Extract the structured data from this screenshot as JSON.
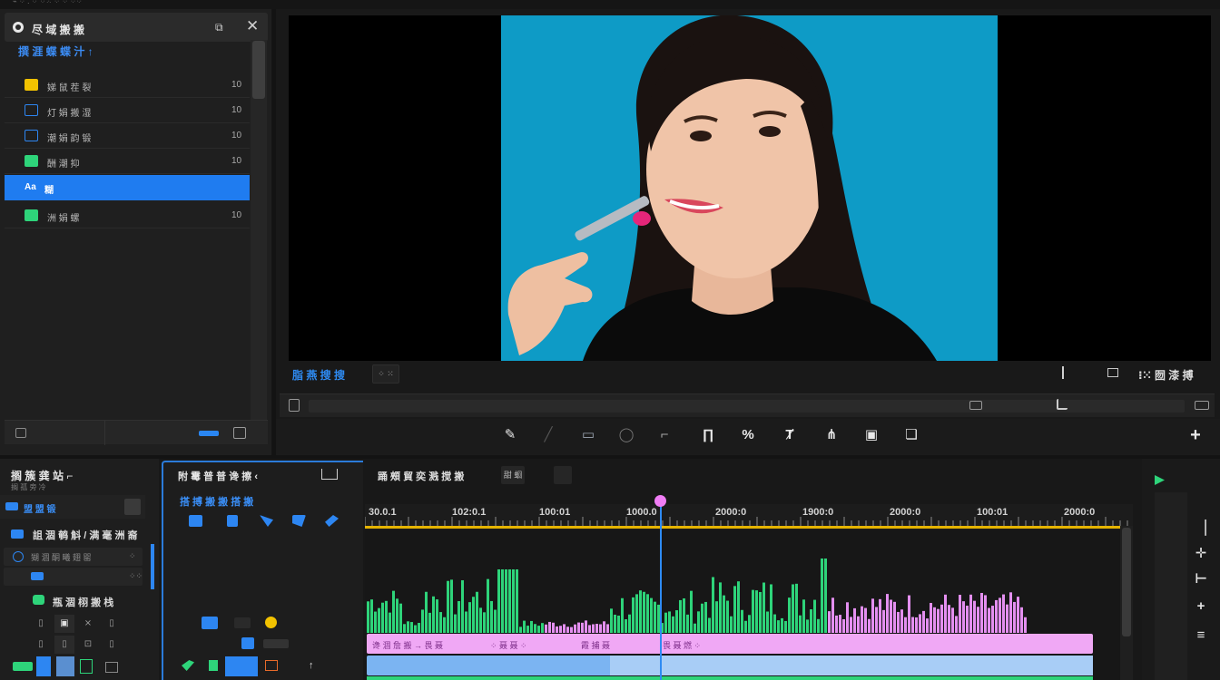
{
  "window": {
    "top_strip": "⌁ ⁘ ⁚ ⁘ ⁘⁙ ⁘ ⁘ ⁘⁘"
  },
  "left_panel": {
    "title": "尽 域 搬 搬",
    "section_title": "撰 涯 蝶 蝶 汁 ↑",
    "items": [
      {
        "label": "娣 鼠 茬 裂",
        "value": "10",
        "icon": "yellow-folder-icon",
        "color": "#f2c200"
      },
      {
        "label": "灯  娟 搬 湿",
        "value": "10",
        "icon": "video-frame-icon",
        "color": "#2d86f2"
      },
      {
        "label": "潮 娟 韵 锻",
        "value": "10",
        "icon": "download-icon",
        "color": "#2d86f2"
      },
      {
        "label": "酬 潮 抑",
        "value": "10",
        "icon": "image-icon",
        "color": "#2ed47a"
      },
      {
        "label": "糊",
        "value": "",
        "icon": "ae-icon",
        "color": "#1f7cf0",
        "active": true,
        "prefix": "Aa"
      },
      {
        "label": "洲 娟 螺",
        "value": "10",
        "icon": "grid-icon",
        "color": "#2ed47a"
      }
    ]
  },
  "viewer": {
    "label": "脂 燕 搜 搜",
    "badge": "⁘ ⁙",
    "right_label": "⁝⁙ 囫 漆 搏",
    "image_desc": "preview-frame"
  },
  "scrubber": {
    "icons": [
      "film-icon",
      "marker-icon",
      "marker-icon",
      "ruler-icon"
    ]
  },
  "toolbar": {
    "items": [
      "✎",
      "╱",
      "▭",
      "◯",
      "⌐",
      "∏",
      "%",
      "Ⱦ",
      "⋔",
      "▣",
      "❏",
      "+"
    ]
  },
  "project": {
    "title": "搁 簇 龚 站 ⌐",
    "subtitle": "搁 孤 旁 冷",
    "row1_label": "盟 盟 锻",
    "folder": "詛 涸 鹌 斛 / 满 毫 洲 裔",
    "items": [
      {
        "label": "猢 涸 酮 曦 翅 罂",
        "num": "⁘"
      },
      {
        "label": "",
        "num": "⁘⁘"
      }
    ],
    "green_label": "瓶 涸 栩 搬 栈",
    "grid": [
      "▯",
      "▣",
      "⨯",
      "▯",
      "▯",
      "▯",
      "⊡",
      "▯"
    ]
  },
  "track_header": {
    "title": "附 霉 普 普 谗 擦 ‹",
    "subtitle": "搭 搏 搬 搬 搭 搬",
    "tools": [
      "rectangle-icon",
      "rectangle-icon",
      "shape-icon",
      "flag-icon",
      "pen-icon"
    ]
  },
  "timeline": {
    "title": "踊 頰 貿 奕 溅 搅 搬",
    "btn1": "甜 蛔",
    "ruler": [
      "30.0.1",
      "102:0.1",
      "100:01",
      "1000.0",
      "2000:0",
      "1900:0",
      "2000:0",
      "100:01",
      "2000:0"
    ],
    "pink_labels": [
      "谗 涸 詹 搬 → 畏 聂",
      "⁘ 聂 聂 ⁘",
      "霞 捕 聂",
      "畏 聂 燃 ⁘"
    ],
    "playhead_position_pct": 39.3
  },
  "colors": {
    "accent": "#2d86f2",
    "audio_green": "#2ed47a",
    "audio_pink": "#e48ff0",
    "ruler_yellow": "#e6b400",
    "preview_bg": "#0e9bc6"
  }
}
